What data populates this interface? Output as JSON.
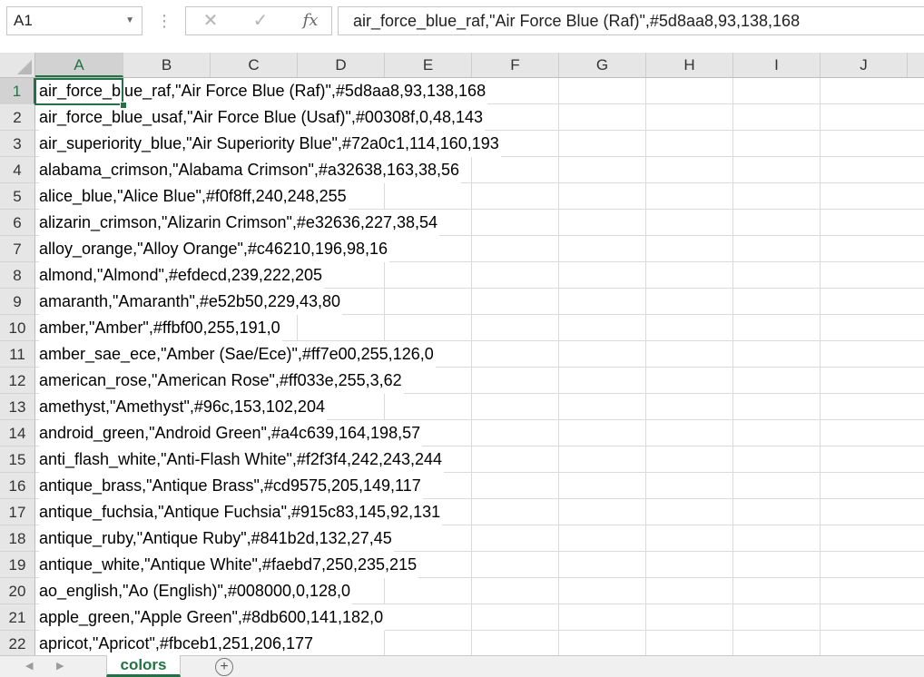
{
  "name_box": {
    "value": "A1"
  },
  "formula_bar": {
    "cancel_icon": "✕",
    "enter_icon": "✓",
    "fx_label": "fx",
    "value": "air_force_blue_raf,\"Air Force Blue (Raf)\",#5d8aa8,93,138,168"
  },
  "columns": [
    "A",
    "B",
    "C",
    "D",
    "E",
    "F",
    "G",
    "H",
    "I",
    "J"
  ],
  "rows": [
    {
      "num": "1",
      "text": "air_force_blue_raf,\"Air Force Blue (Raf)\",#5d8aa8,93,138,168"
    },
    {
      "num": "2",
      "text": "air_force_blue_usaf,\"Air Force Blue (Usaf)\",#00308f,0,48,143"
    },
    {
      "num": "3",
      "text": "air_superiority_blue,\"Air Superiority Blue\",#72a0c1,114,160,193"
    },
    {
      "num": "4",
      "text": "alabama_crimson,\"Alabama Crimson\",#a32638,163,38,56"
    },
    {
      "num": "5",
      "text": "alice_blue,\"Alice Blue\",#f0f8ff,240,248,255"
    },
    {
      "num": "6",
      "text": "alizarin_crimson,\"Alizarin Crimson\",#e32636,227,38,54"
    },
    {
      "num": "7",
      "text": "alloy_orange,\"Alloy Orange\",#c46210,196,98,16"
    },
    {
      "num": "8",
      "text": "almond,\"Almond\",#efdecd,239,222,205"
    },
    {
      "num": "9",
      "text": "amaranth,\"Amaranth\",#e52b50,229,43,80"
    },
    {
      "num": "10",
      "text": "amber,\"Amber\",#ffbf00,255,191,0"
    },
    {
      "num": "11",
      "text": "amber_sae_ece,\"Amber (Sae/Ece)\",#ff7e00,255,126,0"
    },
    {
      "num": "12",
      "text": "american_rose,\"American Rose\",#ff033e,255,3,62"
    },
    {
      "num": "13",
      "text": "amethyst,\"Amethyst\",#96c,153,102,204"
    },
    {
      "num": "14",
      "text": "android_green,\"Android Green\",#a4c639,164,198,57"
    },
    {
      "num": "15",
      "text": "anti_flash_white,\"Anti-Flash White\",#f2f3f4,242,243,244"
    },
    {
      "num": "16",
      "text": "antique_brass,\"Antique Brass\",#cd9575,205,149,117"
    },
    {
      "num": "17",
      "text": "antique_fuchsia,\"Antique Fuchsia\",#915c83,145,92,131"
    },
    {
      "num": "18",
      "text": "antique_ruby,\"Antique Ruby\",#841b2d,132,27,45"
    },
    {
      "num": "19",
      "text": "antique_white,\"Antique White\",#faebd7,250,235,215"
    },
    {
      "num": "20",
      "text": "ao_english,\"Ao (English)\",#008000,0,128,0"
    },
    {
      "num": "21",
      "text": "apple_green,\"Apple Green\",#8db600,141,182,0"
    },
    {
      "num": "22",
      "text": "apricot,\"Apricot\",#fbceb1,251,206,177"
    }
  ],
  "sheet_tabs": [
    {
      "label": "colors",
      "active": true
    }
  ],
  "add_sheet_icon": "+",
  "accent_color": "#217346"
}
